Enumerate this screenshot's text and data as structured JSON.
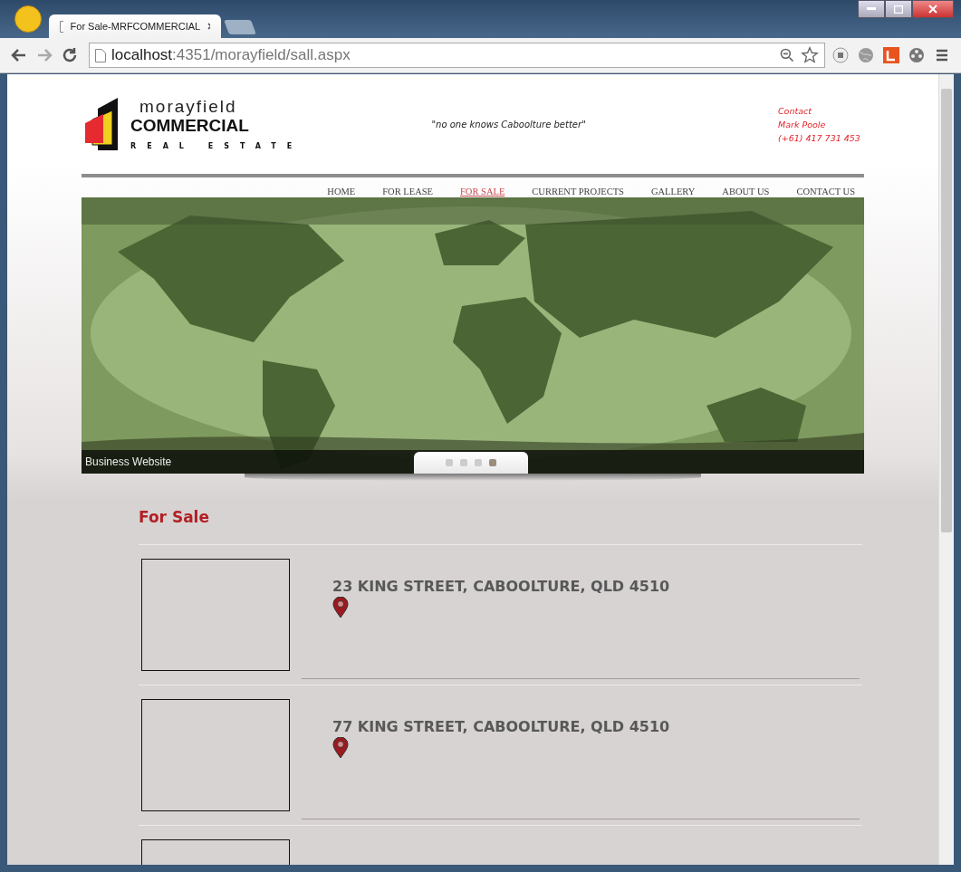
{
  "browser": {
    "tab_title": "For Sale-MRFCOMMERCIAL",
    "address": {
      "host": "localhost",
      "rest": ":4351/morayfield/sall.aspx"
    }
  },
  "header": {
    "logo": {
      "line1": "morayfield",
      "line2": "COMMERCIAL",
      "line3": "REAL ESTATE"
    },
    "tagline": "\"no one knows Caboolture better\"",
    "contact": [
      "Contact",
      "Mark Poole",
      "(+61) 417 731 453"
    ]
  },
  "nav": [
    {
      "label": "HOME",
      "selected": false
    },
    {
      "label": "FOR LEASE",
      "selected": false
    },
    {
      "label": "FOR SALE",
      "selected": true
    },
    {
      "label": "CURRENT PROJECTS",
      "selected": false
    },
    {
      "label": "GALLERY",
      "selected": false
    },
    {
      "label": "ABOUT US",
      "selected": false
    },
    {
      "label": "CONTACT US",
      "selected": false
    }
  ],
  "banner": {
    "kind": "picture",
    "caption": "Business Website",
    "dots": [
      {
        "selected": false
      },
      {
        "selected": false
      },
      {
        "selected": false
      },
      {
        "selected": true
      }
    ]
  },
  "section_title": "For Sale",
  "listings": [
    {
      "address": "23 KING STREET, CABOOLTURE, QLD 4510"
    },
    {
      "address": "77 KING STREET, CABOOLTURE, QLD 4510"
    },
    {
      "kind": "cut"
    }
  ]
}
